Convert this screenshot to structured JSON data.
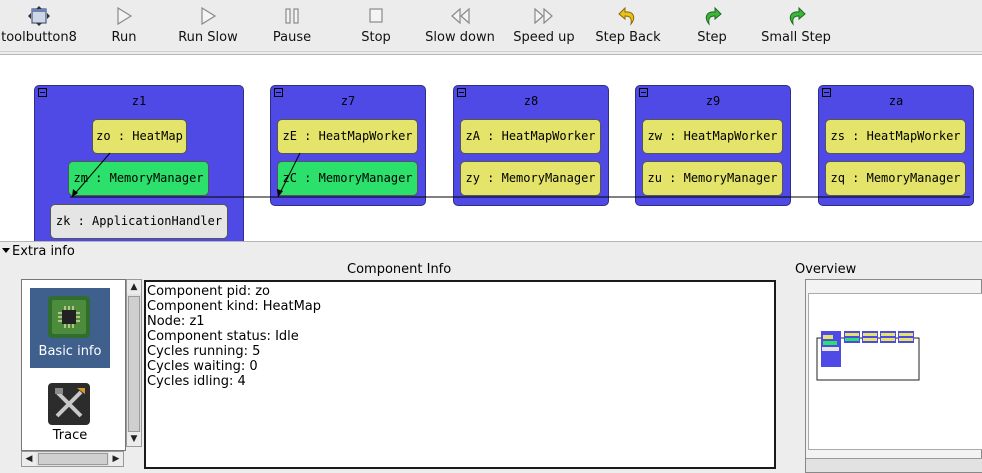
{
  "toolbar": {
    "buttons": [
      {
        "label": "toolbutton8",
        "icon": "window-icon"
      },
      {
        "label": "Run",
        "icon": "play-icon"
      },
      {
        "label": "Run Slow",
        "icon": "play-slow-icon"
      },
      {
        "label": "Pause",
        "icon": "pause-icon"
      },
      {
        "label": "Stop",
        "icon": "stop-icon"
      },
      {
        "label": "Slow down",
        "icon": "rewind-icon"
      },
      {
        "label": "Speed up",
        "icon": "fast-forward-icon"
      },
      {
        "label": "Step Back",
        "icon": "undo-arrow-icon"
      },
      {
        "label": "Step",
        "icon": "redo-arrow-icon"
      },
      {
        "label": "Small Step",
        "icon": "redo-arrow-icon"
      }
    ]
  },
  "graph": {
    "nodes": [
      {
        "name": "z1",
        "components": [
          {
            "label": "zo : HeatMap",
            "kind": "yellow"
          },
          {
            "label": "zm : MemoryManager",
            "kind": "green"
          },
          {
            "label": "zk : ApplicationHandler",
            "kind": "gray"
          }
        ]
      },
      {
        "name": "z7",
        "components": [
          {
            "label": "zE : HeatMapWorker",
            "kind": "yellow"
          },
          {
            "label": "zC : MemoryManager",
            "kind": "green"
          }
        ]
      },
      {
        "name": "z8",
        "components": [
          {
            "label": "zA : HeatMapWorker",
            "kind": "yellow"
          },
          {
            "label": "zy : MemoryManager",
            "kind": "yellow"
          }
        ]
      },
      {
        "name": "z9",
        "components": [
          {
            "label": "zw : HeatMapWorker",
            "kind": "yellow"
          },
          {
            "label": "zu : MemoryManager",
            "kind": "yellow"
          }
        ]
      },
      {
        "name": "za",
        "components": [
          {
            "label": "zs : HeatMapWorker",
            "kind": "yellow"
          },
          {
            "label": "zq : MemoryManager",
            "kind": "yellow"
          }
        ]
      }
    ],
    "colors": {
      "node": "#4f4ae6",
      "yellow": "#e4e46a",
      "green": "#2be06b",
      "gray": "#e5e5e5"
    }
  },
  "extra_info": {
    "header": "Extra info",
    "component_info_title": "Component Info",
    "overview_title": "Overview",
    "side_items": [
      {
        "label": "Basic info",
        "icon": "chip-icon",
        "selected": true
      },
      {
        "label": "Trace",
        "icon": "tools-icon",
        "selected": false
      }
    ],
    "info_lines": [
      "Component pid: zo",
      "Component kind: HeatMap",
      "Node: z1",
      "Component status: Idle",
      "Cycles running: 5",
      "Cycles waiting: 0",
      "Cycles idling: 4"
    ]
  }
}
